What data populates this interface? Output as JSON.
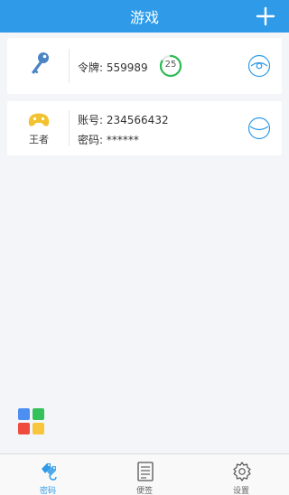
{
  "header": {
    "title": "游戏"
  },
  "token_entry": {
    "token_label": "令牌:",
    "token_value": "559989",
    "countdown": "25",
    "countdown_progress": 0.83
  },
  "account_entry": {
    "game_name": "王者",
    "account_label": "账号:",
    "account_value": "234566432",
    "password_label": "密码:",
    "password_value": "******"
  },
  "tabbar": {
    "tabs": [
      {
        "label": "密码",
        "icon": "password-tags-icon",
        "active": true
      },
      {
        "label": "便签",
        "icon": "note-icon",
        "active": false
      },
      {
        "label": "设置",
        "icon": "gear-icon",
        "active": false
      }
    ]
  },
  "colors": {
    "primary": "#2f9be8",
    "countdown_ring": "#2dbb55",
    "game_icon": "#f2c230",
    "apps": [
      "#4d8ff0",
      "#34c05a",
      "#ee4b3e",
      "#f8c63a"
    ]
  }
}
